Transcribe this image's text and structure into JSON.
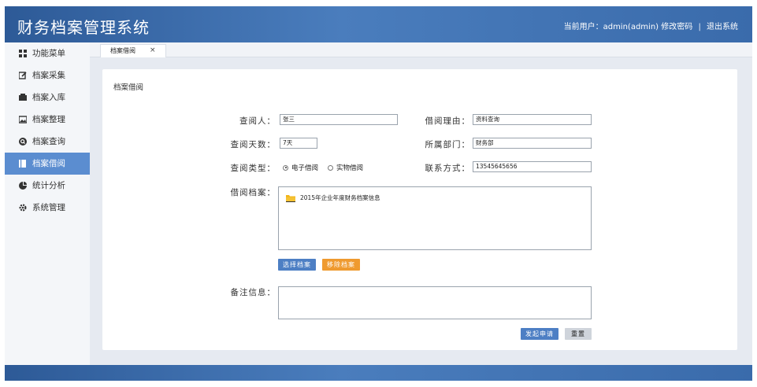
{
  "app": {
    "title": "财务档案管理系统",
    "user_label": "当前用户：admin(admin)",
    "change_password": "修改密码",
    "separator": "|",
    "logout": "退出系统"
  },
  "sidebar": {
    "items": [
      {
        "label": "功能菜单",
        "icon": "grid-icon"
      },
      {
        "label": "档案采集",
        "icon": "edit-icon"
      },
      {
        "label": "档案入库",
        "icon": "inbox-icon"
      },
      {
        "label": "档案整理",
        "icon": "image-icon"
      },
      {
        "label": "档案查询",
        "icon": "search-circle-icon"
      },
      {
        "label": "档案借阅",
        "icon": "book-icon",
        "active": true
      },
      {
        "label": "统计分析",
        "icon": "pie-chart-icon"
      },
      {
        "label": "系统管理",
        "icon": "gear-icon"
      }
    ]
  },
  "tabs": [
    {
      "label": "档案借阅",
      "close": "×"
    }
  ],
  "form": {
    "title": "档案借阅",
    "borrower_label": "查阅人：",
    "borrower_value": "张三",
    "reason_label": "借阅理由：",
    "reason_value": "资料查询",
    "days_label": "查阅天数：",
    "days_value": "7天",
    "dept_label": "所属部门：",
    "dept_value": "财务部",
    "type_label": "查阅类型：",
    "type_options": [
      {
        "label": "电子借阅",
        "checked": true
      },
      {
        "label": "实物借阅",
        "checked": false
      }
    ],
    "contact_label": "联系方式：",
    "contact_value": "13545645656",
    "files_label": "借阅档案：",
    "files": [
      "2015年企业年度财务档案信息"
    ],
    "select_button": "选择档案",
    "remove_button": "移除档案",
    "remarks_label": "备注信息：",
    "remarks_value": "",
    "submit_button": "发起申请",
    "reset_button": "重置"
  },
  "colors": {
    "header": "#3a6bab",
    "active_menu": "#5b8dd0",
    "btn_blue": "#4d7fc4",
    "btn_orange": "#ef9a2f",
    "folder": "#f2b418"
  }
}
